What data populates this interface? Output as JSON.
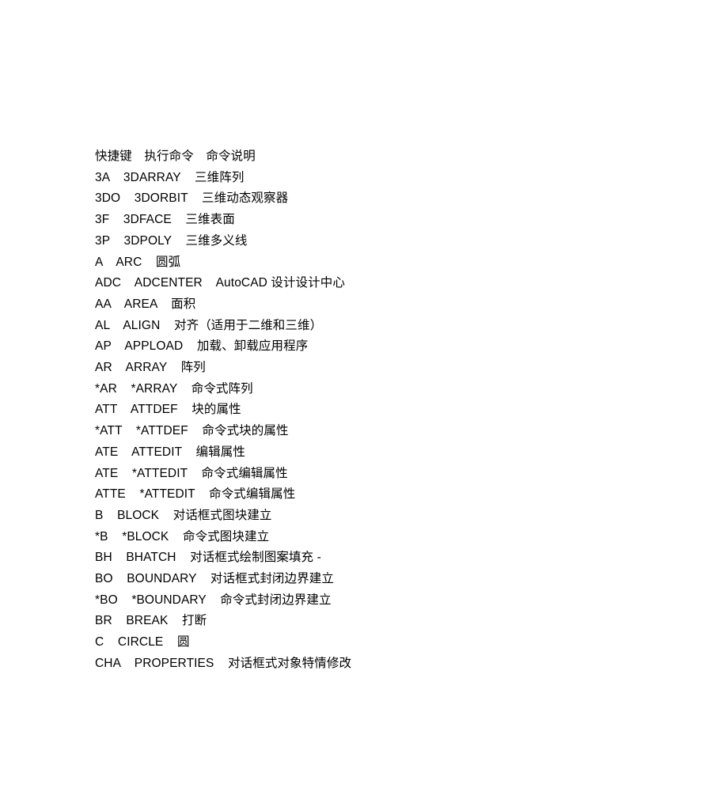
{
  "document": {
    "background_color": "#ffffff",
    "text_color": "#000000",
    "header": {
      "shortcut_label": "快捷键",
      "command_label": "执行命令",
      "description_label": "命令说明",
      "line": "快捷键　执行命令　命令说明"
    },
    "rows": [
      {
        "shortcut": "3A",
        "command": "3DARRAY",
        "description": "三维阵列",
        "line": "3A    3DARRAY    三维阵列"
      },
      {
        "shortcut": "3DO",
        "command": "3DORBIT",
        "description": "三维动态观察器",
        "line": "3DO    3DORBIT    三维动态观察器"
      },
      {
        "shortcut": "3F",
        "command": "3DFACE",
        "description": "三维表面",
        "line": "3F    3DFACE    三维表面"
      },
      {
        "shortcut": "3P",
        "command": "3DPOLY",
        "description": "三维多义线",
        "line": "3P    3DPOLY    三维多义线"
      },
      {
        "shortcut": "A",
        "command": "ARC",
        "description": "圆弧",
        "line": "A    ARC    圆弧"
      },
      {
        "shortcut": "ADC",
        "command": "ADCENTER",
        "description": "AutoCAD 设计设计中心",
        "line": "ADC    ADCENTER    AutoCAD 设计设计中心"
      },
      {
        "shortcut": "AA",
        "command": "AREA",
        "description": "面积",
        "line": "AA    AREA    面积"
      },
      {
        "shortcut": "AL",
        "command": "ALIGN",
        "description": "对齐（适用于二维和三维）",
        "line": "AL    ALIGN    对齐（适用于二维和三维）"
      },
      {
        "shortcut": "AP",
        "command": "APPLOAD",
        "description": "加载、卸载应用程序",
        "line": "AP    APPLOAD    加载、卸载应用程序"
      },
      {
        "shortcut": "AR",
        "command": "ARRAY",
        "description": "阵列",
        "line": "AR    ARRAY    阵列"
      },
      {
        "shortcut": "*AR",
        "command": "*ARRAY",
        "description": "命令式阵列",
        "line": "*AR    *ARRAY    命令式阵列"
      },
      {
        "shortcut": "ATT",
        "command": "ATTDEF",
        "description": "块的属性",
        "line": "ATT    ATTDEF    块的属性"
      },
      {
        "shortcut": "*ATT",
        "command": "*ATTDEF",
        "description": "命令式块的属性",
        "line": "*ATT    *ATTDEF    命令式块的属性"
      },
      {
        "shortcut": "ATE",
        "command": "ATTEDIT",
        "description": "编辑属性",
        "line": "ATE    ATTEDIT    编辑属性"
      },
      {
        "shortcut": "ATE",
        "command": "*ATTEDIT",
        "description": "命令式编辑属性",
        "line": "ATE    *ATTEDIT    命令式编辑属性"
      },
      {
        "shortcut": "ATTE",
        "command": "*ATTEDIT",
        "description": "命令式编辑属性",
        "line": "ATTE    *ATTEDIT    命令式编辑属性"
      },
      {
        "shortcut": "B",
        "command": "BLOCK",
        "description": "对话框式图块建立",
        "line": "B    BLOCK    对话框式图块建立"
      },
      {
        "shortcut": "*B",
        "command": "*BLOCK",
        "description": "命令式图块建立",
        "line": "*B    *BLOCK    命令式图块建立"
      },
      {
        "shortcut": "BH",
        "command": "BHATCH",
        "description": "对话框式绘制图案填充 -",
        "line": "BH    BHATCH    对话框式绘制图案填充 -"
      },
      {
        "shortcut": "BO",
        "command": "BOUNDARY",
        "description": "对话框式封闭边界建立",
        "line": "BO    BOUNDARY    对话框式封闭边界建立"
      },
      {
        "shortcut": "*BO",
        "command": "*BOUNDARY",
        "description": "命令式封闭边界建立",
        "line": "*BO    *BOUNDARY    命令式封闭边界建立"
      },
      {
        "shortcut": "BR",
        "command": "BREAK",
        "description": "打断",
        "line": "BR    BREAK    打断"
      },
      {
        "shortcut": "C",
        "command": "CIRCLE",
        "description": "圆",
        "line": "C    CIRCLE    圆"
      },
      {
        "shortcut": "CHA",
        "command": "PROPERTIES",
        "description": "对话框式对象特情修改",
        "line": "CHA    PROPERTIES    对话框式对象特情修改"
      }
    ]
  }
}
